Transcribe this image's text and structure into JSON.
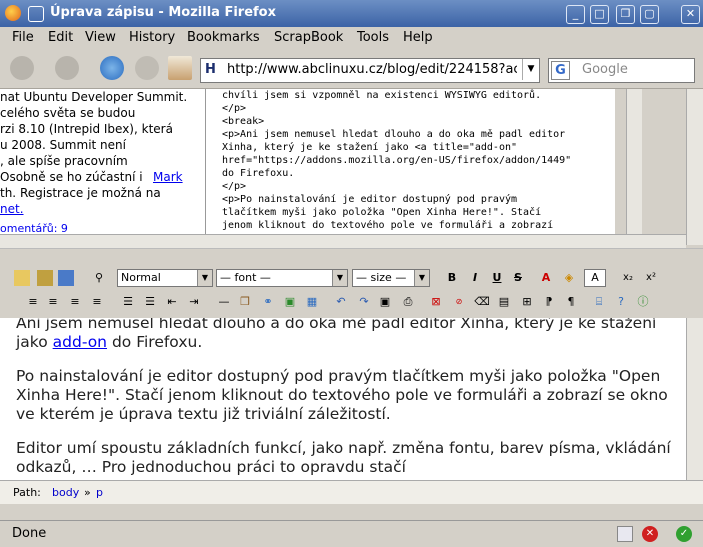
{
  "window": {
    "title": "Úprava zápisu - Mozilla Firefox",
    "controls": [
      "_",
      "□",
      "❐",
      "▢",
      "✕"
    ]
  },
  "menu": [
    "File",
    "Edit",
    "View",
    "History",
    "Bookmarks",
    "ScrapBook",
    "Tools",
    "Help"
  ],
  "nav": {
    "url": "http://www.abclinuxu.cz/blog/edit/224158?acti",
    "search_placeholder": "Google",
    "search_engine_label": "G",
    "site_icon": "H"
  },
  "page_left": {
    "lines": [
      "nat Ubuntu Developer Summit.",
      "celého světa se budou",
      "rzi 8.10 (Intrepid Ibex), která",
      "u 2008. Summit není",
      ", ale spíše pracovním",
      "Osobně se ho zúčastní i",
      "th. Registrace je možná na",
      "net.",
      "omentářů: 9"
    ],
    "link_mark": "Mark"
  },
  "page_source": {
    "lines": [
      "chvíli jsem si vzpomněl na existenci WYSIWYG editorů.",
      "</p>",
      "<break>",
      "<p>Ani jsem nemusel hledat dlouho a do oka mě padl editor",
      "Xinha, který je ke stažení jako <a title=\"add-on\"",
      "href=\"https://addons.mozilla.org/en-US/firefox/addon/1449\"",
      "do Firefoxu.",
      "</p>",
      "<p>Po nainstalování je editor dostupný pod pravým",
      "tlačítkem myši jako položka \"Open Xinha Here!\". Stačí",
      "jenom kliknout do textového pole ve formuláři a zobrazí"
    ]
  },
  "toolbar": {
    "format_select": "Normal",
    "font_select": "— font —",
    "size_select": "— size —",
    "color_box": "A"
  },
  "editor": {
    "line1": "Ani jsem nemusel hledat dlouho a do oka mě padl editor Xinha, který je ke stažení",
    "line2_pre": "jako ",
    "line2_link": "add-on",
    "line2_post": " do Firefoxu.",
    "para2_line1": "Po nainstalování je editor dostupný pod pravým tlačítkem myši jako položka \"Open",
    "para2_line2": "Xinha Here!\". Stačí jenom kliknout do textového pole ve formuláři a zobrazí se okno",
    "para2_line3": "ve kterém je úprava textu již triviální záležitostí.",
    "para3_line1": "Editor umí spoustu základních funkcí, jako např. změna fontu, barev písma, vkládání",
    "para3_line2": "odkazů, … Pro jednoduchou práci to opravdu stačí"
  },
  "pathbar": {
    "label": "Path:",
    "body": "body",
    "sep": "»",
    "p": "p"
  },
  "status": {
    "text": "Done"
  }
}
